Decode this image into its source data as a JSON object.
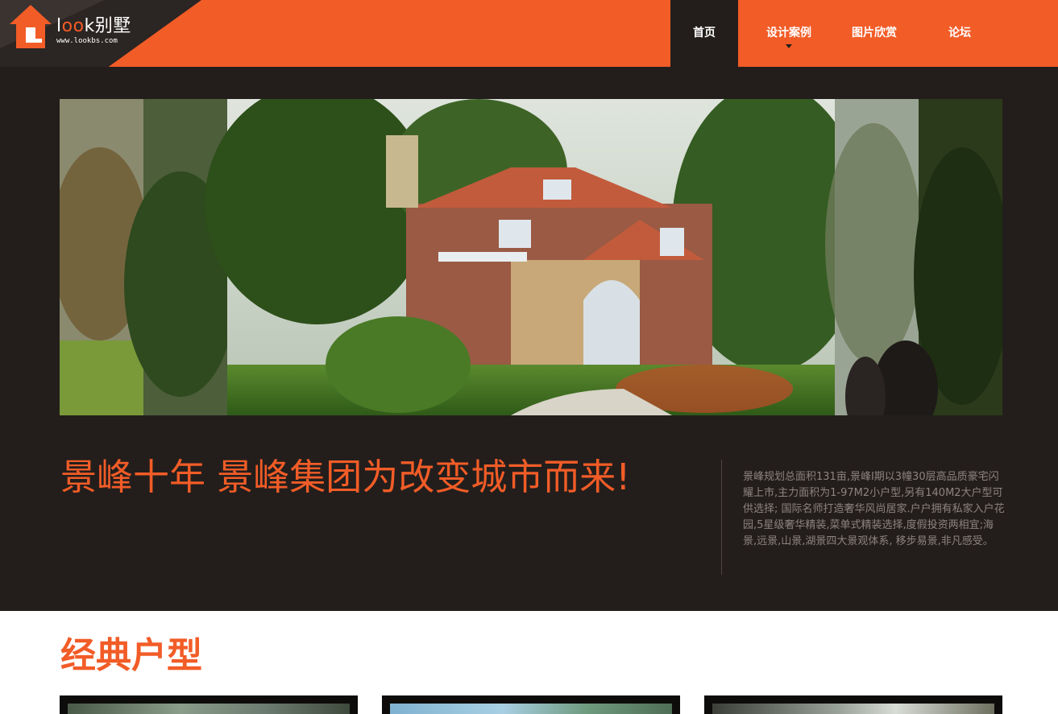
{
  "brand": {
    "name_prefix": "l",
    "name_o": "oo",
    "name_suffix": "k别墅",
    "url": "www.lookbs.com",
    "logo_icon": "house-icon"
  },
  "nav": {
    "items": [
      {
        "label": "首页",
        "active": true
      },
      {
        "label": "设计案例",
        "active": false,
        "has_dropdown": true
      },
      {
        "label": "图片欣赏",
        "active": false
      },
      {
        "label": "论坛",
        "active": false
      }
    ]
  },
  "hero": {
    "headline": "景峰十年 景峰集团为改变城市而来!",
    "intro": "景峰规划总面积131亩,景峰I期以3幢30层高品质豪宅闪耀上市,主力面积为1-97M2小户型,另有140M2大户型可供选择; 国际名师打造奢华风尚居家.户户拥有私家入户花园,5星级奢华精装,菜单式精装选择,度假投资两相宜;海景,远景,山景,湖景四大景观体系, 移步易景,非凡感受。"
  },
  "section": {
    "title": "经典户型"
  },
  "colors": {
    "accent": "#f25c27",
    "dark_bg": "#231e1c",
    "body_text": "#8c8480"
  }
}
